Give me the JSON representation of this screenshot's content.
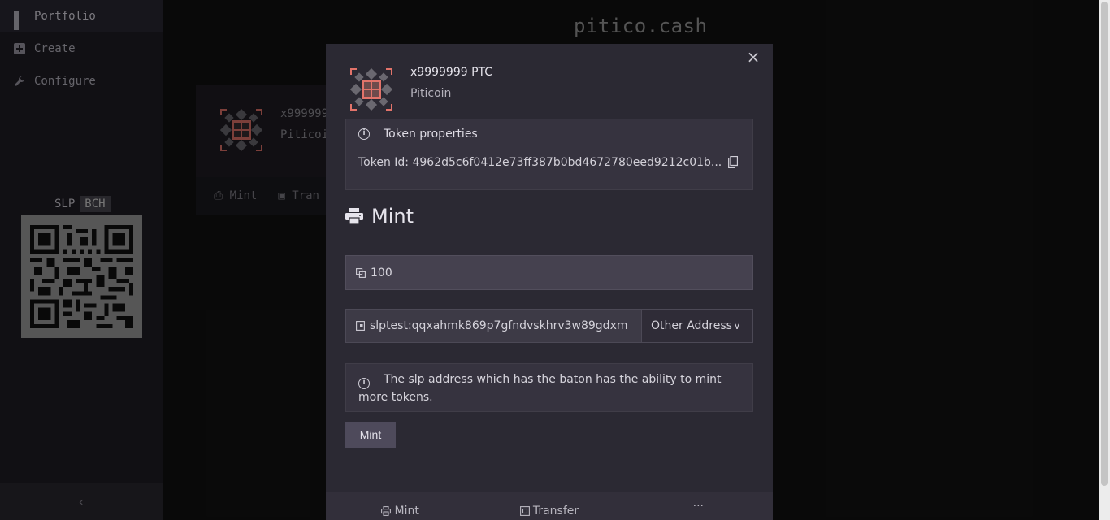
{
  "sidebar": {
    "items": [
      {
        "label": "Portfolio",
        "icon": "grid-icon"
      },
      {
        "label": "Create",
        "icon": "plus-square-icon"
      },
      {
        "label": "Configure",
        "icon": "wrench-icon"
      }
    ],
    "address_toggle": {
      "slp": "SLP",
      "bch": "BCH",
      "selected": "BCH"
    },
    "collapse_icon": "‹"
  },
  "header": {
    "brand": "pitico.cash"
  },
  "background_card": {
    "title": "x999999",
    "name": "Piticoi",
    "actions": [
      "Mint",
      "Tran"
    ]
  },
  "modal": {
    "close": "×",
    "token": {
      "title": "x9999999 PTC",
      "name": "Piticoin"
    },
    "properties": {
      "heading": "Token properties",
      "token_id": "Token Id: 4962d5c6f0412e73ff387b0bd4672780eed9212c01b..."
    },
    "mint": {
      "heading": "Mint",
      "amount": "100",
      "address": "slptest:qqxahmk869p7gfndvskhrv3w89gdxm",
      "address_option": "Other Address",
      "note": "The slp address which has the baton has the ability to mint more tokens.",
      "button": "Mint"
    },
    "actions": {
      "mint": "Mint",
      "transfer": "Transfer",
      "more": "···"
    }
  },
  "colors": {
    "accent": "#e2736a",
    "modal_bg": "#2b2933",
    "sidebar_bg": "#201e26"
  }
}
